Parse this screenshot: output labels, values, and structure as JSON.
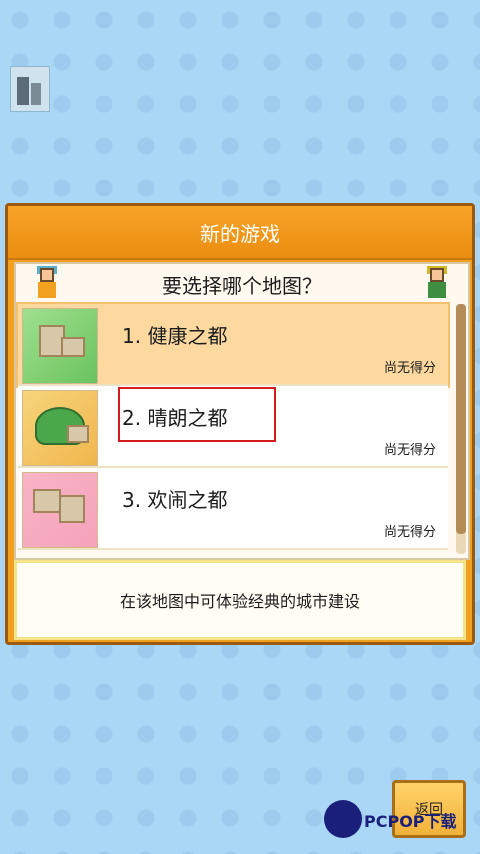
{
  "dialog": {
    "title": "新的游戏",
    "question": "要选择哪个地图？",
    "maps": [
      {
        "label": "1. 健康之都",
        "score": "尚无得分"
      },
      {
        "label": "2. 晴朗之都",
        "score": "尚无得分"
      },
      {
        "label": "3. 欢闹之都",
        "score": "尚无得分"
      }
    ],
    "description": "在该地图中可体验经典的城市建设"
  },
  "back_button": {
    "label": "返回"
  },
  "watermark": {
    "text": "PCPOP下载"
  },
  "colors": {
    "background": "#a9d7f5",
    "dialog_header": "#f1a11f",
    "selected_row": "#fdd9a0",
    "highlight_box": "#d41a1a"
  },
  "icons": [
    "player-thumbnail-icon",
    "npc-left-icon",
    "npc-right-icon",
    "map-thumbnail-icon"
  ]
}
